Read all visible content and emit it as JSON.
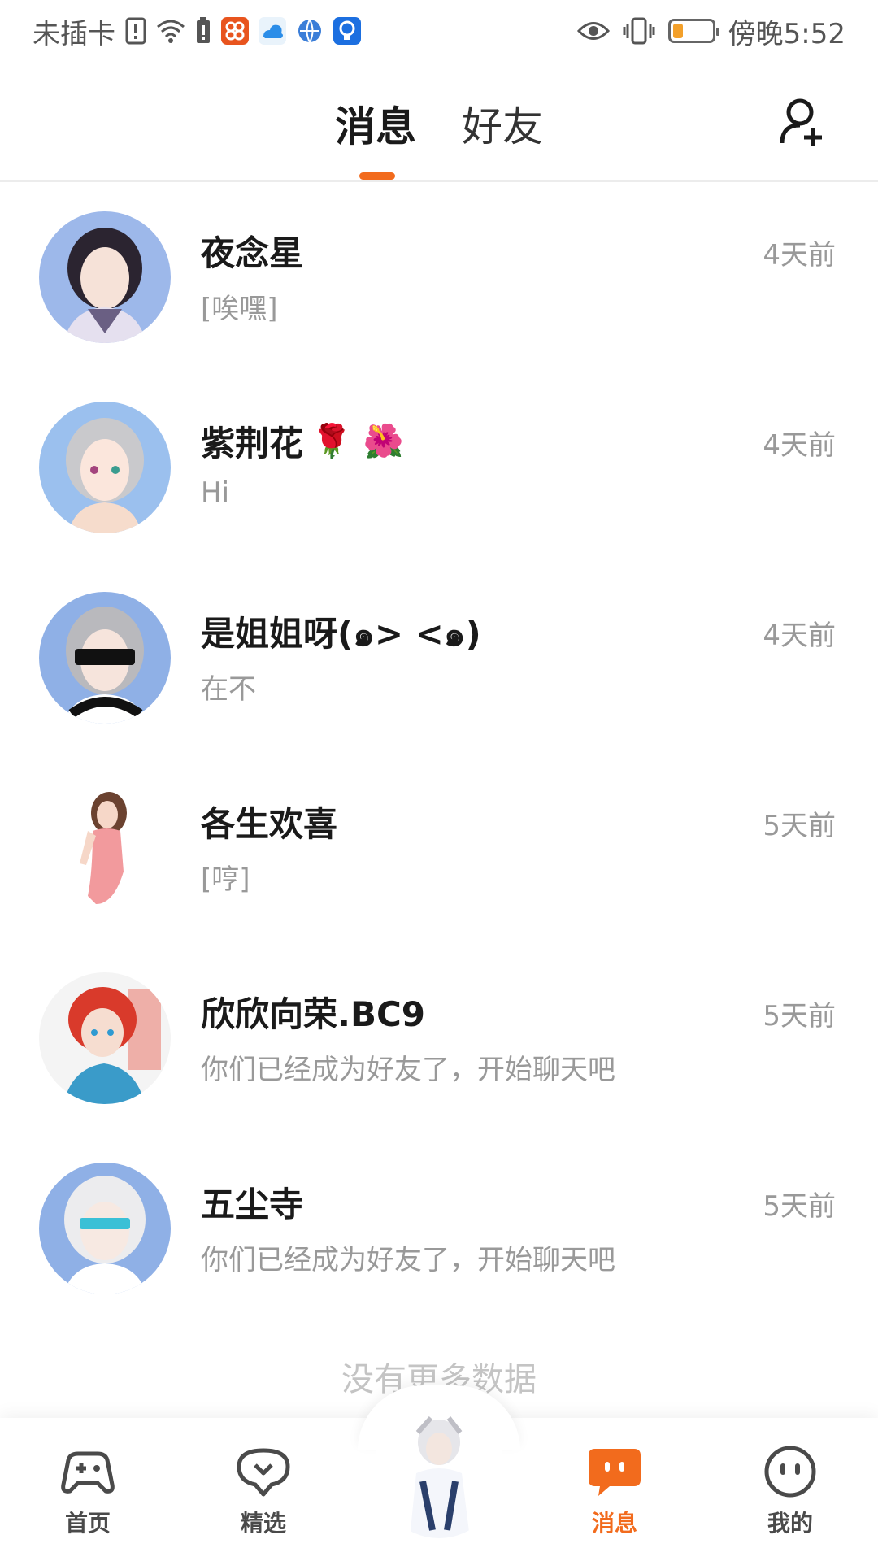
{
  "status_bar": {
    "carrier": "未插卡",
    "time": "傍晚5:52"
  },
  "top_nav": {
    "tabs": [
      "消息",
      "好友"
    ],
    "active_tab": "消息",
    "add_friend_icon": "add-user-icon"
  },
  "conversations": [
    {
      "name": "夜念星",
      "preview": "[唉嘿]",
      "time": "4天前",
      "emoji": ""
    },
    {
      "name": "紫荆花",
      "preview": "Hi",
      "time": "4天前",
      "emoji": "🌹 🌺"
    },
    {
      "name": "是姐姐呀(๑>    <๑)",
      "preview": "在不",
      "time": "4天前",
      "emoji": ""
    },
    {
      "name": "各生欢喜",
      "preview": "[哼]",
      "time": "5天前",
      "emoji": ""
    },
    {
      "name": "欣欣向荣.BC9",
      "preview": "你们已经成为好友了，开始聊天吧",
      "time": "5天前",
      "emoji": ""
    },
    {
      "name": "五尘寺",
      "preview": "你们已经成为好友了，开始聊天吧",
      "time": "5天前",
      "emoji": ""
    }
  ],
  "list_footer": "没有更多数据",
  "bottom_nav": {
    "items": [
      {
        "label": "首页",
        "icon": "gamepad-icon"
      },
      {
        "label": "精选",
        "icon": "heart-chat-icon"
      },
      {
        "label": "消息",
        "icon": "message-icon"
      },
      {
        "label": "我的",
        "icon": "face-icon"
      }
    ],
    "active": "消息"
  },
  "colors": {
    "accent": "#f26b1d",
    "text_primary": "#1a1a1a",
    "text_secondary": "#999999"
  }
}
